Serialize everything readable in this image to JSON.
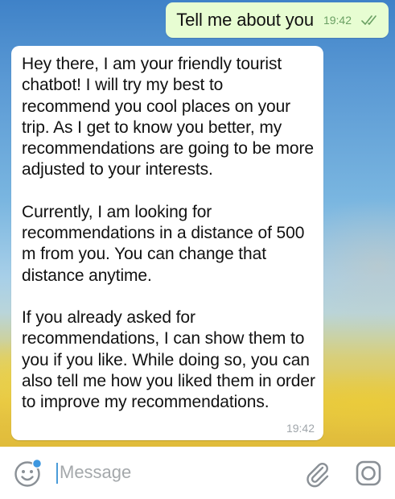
{
  "conversation": {
    "outgoing": {
      "text": "Tell me about you",
      "time": "19:42",
      "status_icon": "double-check-icon"
    },
    "incoming": {
      "paragraphs": [
        "Hey there, I am your friendly tourist chatbot! I will try my best to recommend you cool places on your trip. As I get to know you better, my recommendations are going to be more adjusted to your interests.",
        "Currently, I am looking for recommendations in a distance of 500 m from you. You can change that distance anytime.",
        "If you already asked for recommendations, I can show them to you if you like. While doing so, you can also tell me how you liked them in order to improve my recommendations."
      ],
      "time": "19:42"
    }
  },
  "input_bar": {
    "placeholder": "Message",
    "value": "",
    "icons": [
      "emoji-icon",
      "paperclip-icon",
      "camera-icon"
    ]
  },
  "colors": {
    "outgoing_bubble": "#e7fdd2",
    "incoming_bubble": "#ffffff",
    "accent": "#4a9bd8",
    "outgoing_time": "#6aa063"
  }
}
